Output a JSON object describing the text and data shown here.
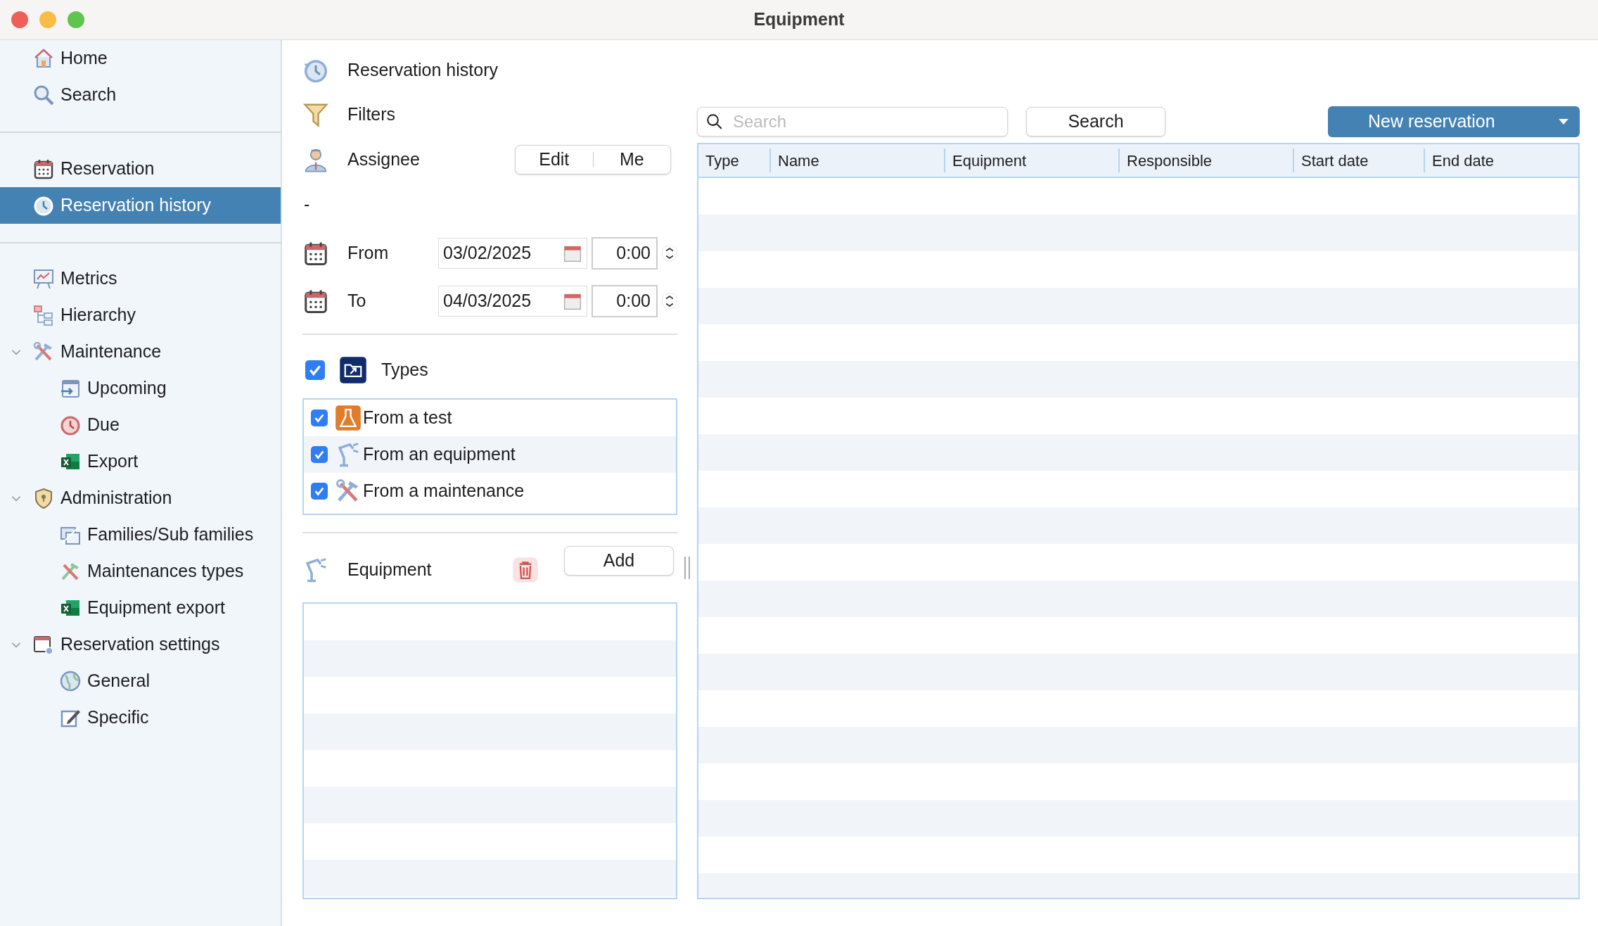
{
  "window": {
    "title": "Equipment"
  },
  "sidebar": {
    "sections": [
      {
        "items": [
          {
            "label": "Home",
            "selected": false
          },
          {
            "label": "Search",
            "selected": false
          }
        ]
      },
      {
        "items": [
          {
            "label": "Reservation",
            "selected": false
          },
          {
            "label": "Reservation history",
            "selected": true
          }
        ]
      },
      {
        "items": [
          {
            "label": "Metrics",
            "selected": false
          },
          {
            "label": "Hierarchy",
            "selected": false
          },
          {
            "label": "Maintenance",
            "selected": false,
            "expanded": true,
            "children": [
              {
                "label": "Upcoming",
                "selected": false
              },
              {
                "label": "Due",
                "selected": false
              },
              {
                "label": "Export",
                "selected": false
              }
            ]
          },
          {
            "label": "Administration",
            "selected": false,
            "expanded": true,
            "children": [
              {
                "label": "Families/Sub families",
                "selected": false
              },
              {
                "label": "Maintenances types",
                "selected": false
              },
              {
                "label": "Equipment export",
                "selected": false
              }
            ]
          },
          {
            "label": "Reservation settings",
            "selected": false,
            "expanded": true,
            "children": [
              {
                "label": "General",
                "selected": false
              },
              {
                "label": "Specific",
                "selected": false
              }
            ]
          }
        ]
      }
    ]
  },
  "filters": {
    "page_title": "Reservation history",
    "label": "Filters",
    "assignee": {
      "label": "Assignee",
      "buttons": [
        "Edit",
        "Me"
      ],
      "value": "-"
    },
    "from": {
      "label": "From",
      "date": "03/02/2025",
      "time": "0:00"
    },
    "to": {
      "label": "To",
      "date": "04/03/2025",
      "time": "0:00"
    },
    "types": {
      "label": "Types",
      "checked": true,
      "items": [
        {
          "label": "From a test",
          "checked": true
        },
        {
          "label": "From an equipment",
          "checked": true
        },
        {
          "label": "From a maintenance",
          "checked": true
        }
      ]
    },
    "equipment": {
      "label": "Equipment",
      "add_button": "Add"
    }
  },
  "toolbar": {
    "search_placeholder": "Search",
    "search_button": "Search",
    "new_button": "New reservation"
  },
  "table": {
    "columns": [
      "Type",
      "Name",
      "Equipment",
      "Responsible",
      "Start date",
      "End date"
    ]
  }
}
